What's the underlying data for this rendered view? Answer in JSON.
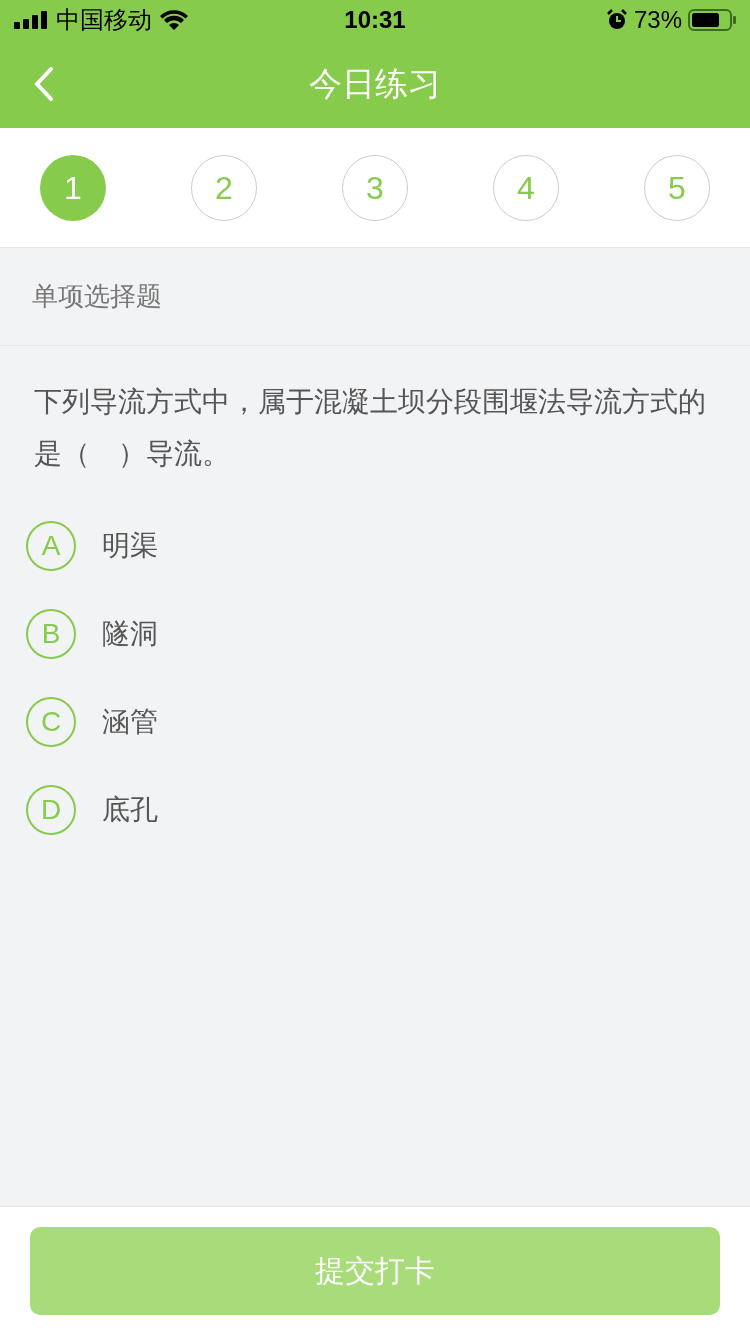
{
  "status_bar": {
    "carrier": "中国移动",
    "time": "10:31",
    "battery": "73%"
  },
  "nav": {
    "title": "今日练习"
  },
  "steps": [
    {
      "label": "1",
      "selected": true
    },
    {
      "label": "2",
      "selected": false
    },
    {
      "label": "3",
      "selected": false
    },
    {
      "label": "4",
      "selected": false
    },
    {
      "label": "5",
      "selected": false
    }
  ],
  "question": {
    "type": "单项选择题",
    "text": "下列导流方式中，属于混凝土坝分段围堰法导流方式的是（　）导流。",
    "options": [
      {
        "letter": "A",
        "text": "明渠"
      },
      {
        "letter": "B",
        "text": "隧洞"
      },
      {
        "letter": "C",
        "text": "涵管"
      },
      {
        "letter": "D",
        "text": "底孔"
      }
    ]
  },
  "submit_button": {
    "label": "提交打卡",
    "disabled": true
  }
}
